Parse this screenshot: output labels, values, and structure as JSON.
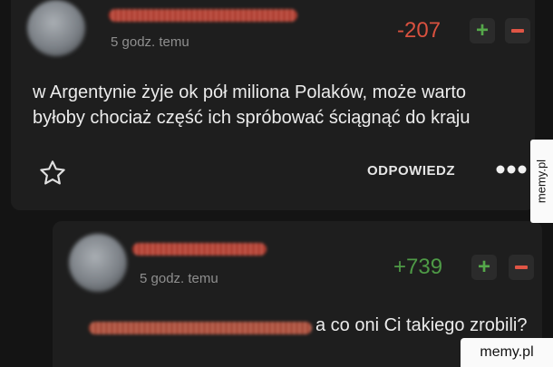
{
  "comment": {
    "timestamp": "5 godz. temu",
    "score": "-207",
    "text": "w Argentynie żyje ok pół miliona Polaków, może warto byłoby chociaż część ich spróbować ściągnąć do kraju",
    "reply_label": "ODPOWIEDZ"
  },
  "reply": {
    "timestamp": "5 godz. temu",
    "score": "+739",
    "text": "a co oni Ci takiego zrobili?"
  },
  "watermark": {
    "side": "memy.pl",
    "bottom": "memy.pl"
  },
  "icons": {
    "vote_up": "plus-icon",
    "vote_down": "minus-icon",
    "favorite": "star-outline-icon",
    "more": "more-dots-icon"
  },
  "colors": {
    "negative_score": "#d9513f",
    "positive_score": "#4e9a46",
    "background": "#141414",
    "card": "#1e1e1e"
  }
}
